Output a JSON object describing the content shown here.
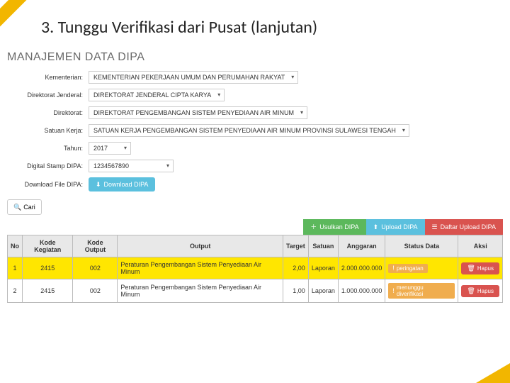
{
  "slide": {
    "title": "3. Tunggu Verifikasi dari Pusat (lanjutan)"
  },
  "app": {
    "title": "MANAJEMEN DATA DIPA",
    "form": {
      "kementerian": {
        "label": "Kementerian:",
        "value": "KEMENTERIAN PEKERJAAN UMUM DAN PERUMAHAN RAKYAT"
      },
      "dirjen": {
        "label": "Direktorat Jenderal:",
        "value": "DIREKTORAT JENDERAL CIPTA KARYA"
      },
      "direktorat": {
        "label": "Direktorat:",
        "value": "DIREKTORAT PENGEMBANGAN SISTEM PENYEDIAAN AIR MINUM"
      },
      "satker": {
        "label": "Satuan Kerja:",
        "value": "SATUAN KERJA PENGEMBANGAN SISTEM PENYEDIAAN AIR MINUM PROVINSI SULAWESI TENGAH"
      },
      "tahun": {
        "label": "Tahun:",
        "value": "2017"
      },
      "stamp": {
        "label": "Digital Stamp DIPA:",
        "value": "1234567890"
      },
      "download": {
        "label": "Download File DIPA:",
        "button": "Download DIPA"
      }
    },
    "search": {
      "label": "Cari"
    },
    "toolbar": {
      "usulkan": "Usulkan DIPA",
      "upload": "Upload DIPA",
      "daftar": "Daftar Upload DIPA"
    },
    "table": {
      "headers": [
        "No",
        "Kode Kegiatan",
        "Kode Output",
        "Output",
        "Target",
        "Satuan",
        "Anggaran",
        "Status Data",
        "Aksi"
      ],
      "rows": [
        {
          "no": "1",
          "kode_kegiatan": "2415",
          "kode_output": "002",
          "output": "Peraturan Pengembangan Sistem Penyediaan Air Minum",
          "target": "2,00",
          "satuan": "Laporan",
          "anggaran": "2.000.000.000",
          "status": "peringatan",
          "highlight": true
        },
        {
          "no": "2",
          "kode_kegiatan": "2415",
          "kode_output": "002",
          "output": "Peraturan Pengembangan Sistem Penyediaan Air Minum",
          "target": "1,00",
          "satuan": "Laporan",
          "anggaran": "1.000.000.000",
          "status": "menunggu diverifikasi",
          "highlight": false
        }
      ],
      "delete_label": "Hapus"
    }
  }
}
